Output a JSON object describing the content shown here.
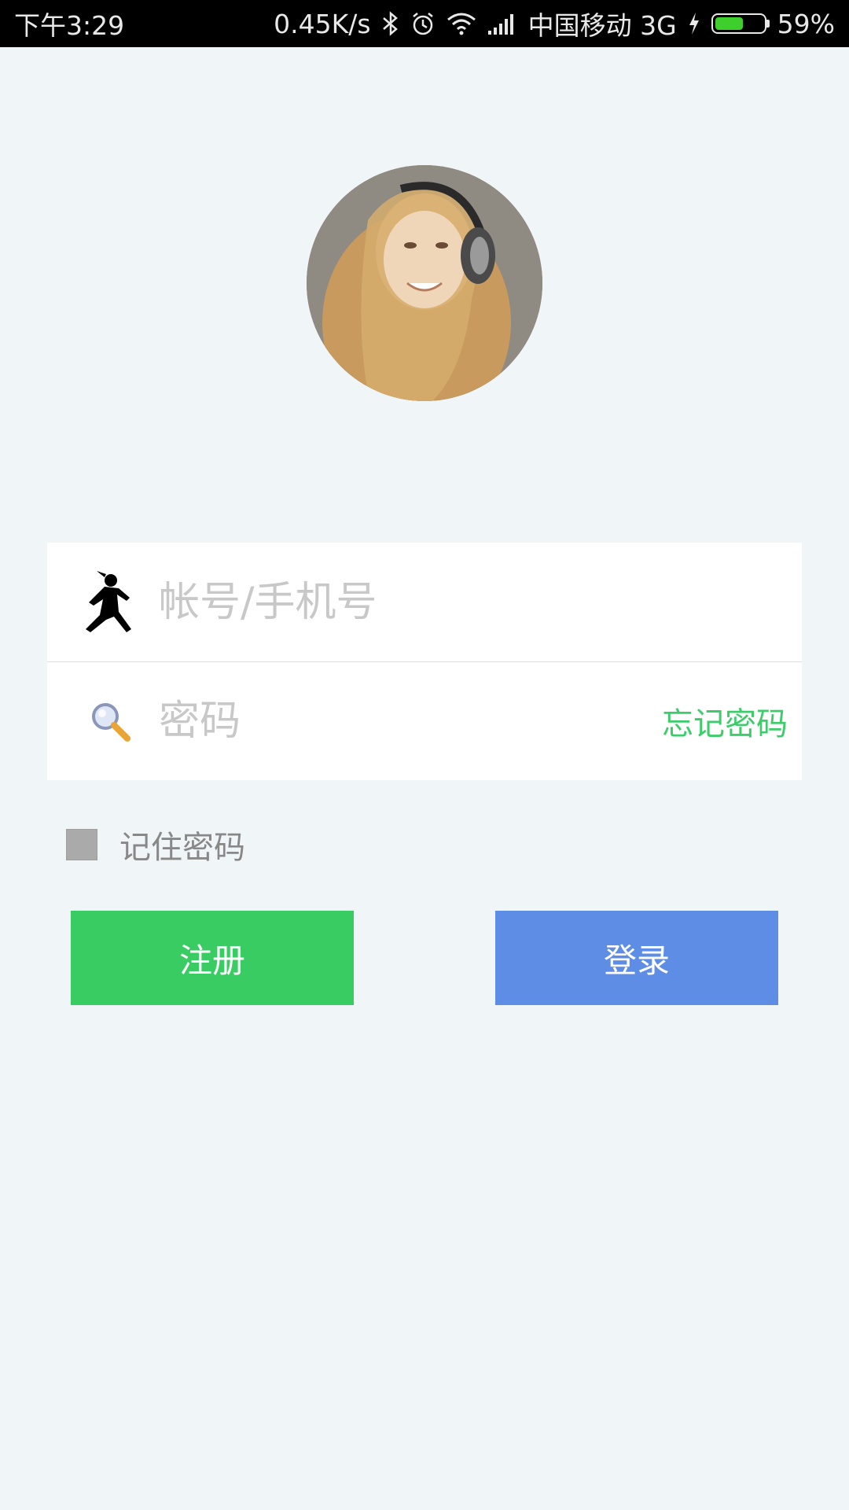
{
  "status_bar": {
    "time": "下午3:29",
    "network_speed": "0.45K/s",
    "carrier": "中国移动 3G",
    "battery_percent": "59%",
    "battery_level": 0.59,
    "icons": [
      "bluetooth-icon",
      "alarm-icon",
      "wifi-icon",
      "signal-icon",
      "charging-icon",
      "battery-icon"
    ]
  },
  "login": {
    "account_placeholder": "帐号/手机号",
    "account_icon": "ninja-icon",
    "password_placeholder": "密码",
    "password_icon": "magnifier-icon",
    "forgot_password": "忘记密码",
    "remember_password": "记住密码",
    "register_button": "注册",
    "login_button": "登录"
  },
  "colors": {
    "background": "#f0f5f8",
    "accent_green": "#39cc62",
    "accent_blue": "#5e8de6",
    "link_green": "#3dcc6a"
  }
}
